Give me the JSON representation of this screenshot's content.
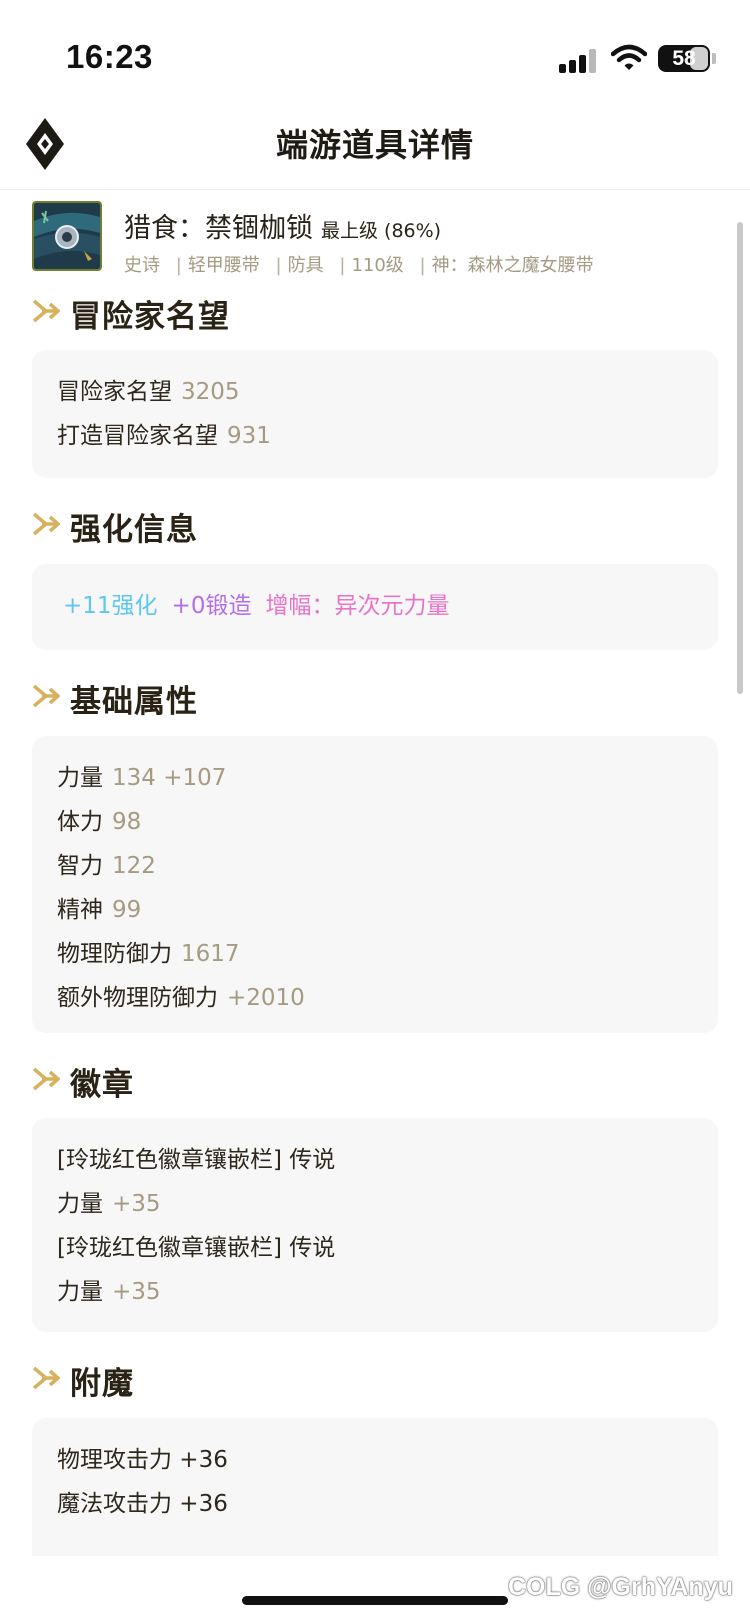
{
  "status_bar": {
    "time": "16:23",
    "battery": "58"
  },
  "nav": {
    "title": "端游道具详情"
  },
  "item": {
    "name": "猎食：禁锢枷锁",
    "grade": "最上级 (86%)",
    "meta": [
      "史诗",
      "轻甲腰带",
      "防具",
      "110级",
      "神：森林之魔女腰带"
    ]
  },
  "sections": {
    "reputation": {
      "title": "冒险家名望",
      "rows": [
        {
          "label": "冒险家名望",
          "value": "3205"
        },
        {
          "label": "打造冒险家名望",
          "value": "931"
        }
      ]
    },
    "enhance": {
      "title": "强化信息",
      "reinforce": "+11强化",
      "forge": "+0锻造",
      "amplify": "增幅：异次元力量",
      "colors": {
        "reinforce": "#5ec8ec",
        "forge": "#b56ee8",
        "amplify": "#e873c8"
      }
    },
    "base_stats": {
      "title": "基础属性",
      "rows": [
        {
          "label": "力量",
          "value": "134 +107"
        },
        {
          "label": "体力",
          "value": "98"
        },
        {
          "label": "智力",
          "value": "122"
        },
        {
          "label": "精神",
          "value": "99"
        },
        {
          "label": "物理防御力",
          "value": "1617"
        },
        {
          "label": "额外物理防御力",
          "value": "+2010"
        }
      ]
    },
    "emblem": {
      "title": "徽章",
      "rows": [
        {
          "label": "[玲珑红色徽章镶嵌栏] 传说",
          "value": ""
        },
        {
          "label": "力量",
          "value": "+35"
        },
        {
          "label": "[玲珑红色徽章镶嵌栏] 传说",
          "value": ""
        },
        {
          "label": "力量",
          "value": "+35"
        }
      ]
    },
    "enchant": {
      "title": "附魔",
      "rows": [
        {
          "label": "物理攻击力 +36"
        },
        {
          "label": "魔法攻击力 +36"
        }
      ]
    }
  },
  "icons": {
    "logo": "diamond-logo-icon",
    "section": "double-arrow-icon",
    "signal": "cellular-signal-icon",
    "wifi": "wifi-icon",
    "battery": "battery-icon"
  },
  "watermark": "COLG @GrhYAnyu",
  "colors": {
    "accent": "#d8b15e",
    "value": "#a69a80",
    "card_bg": "#f7f7f7"
  }
}
